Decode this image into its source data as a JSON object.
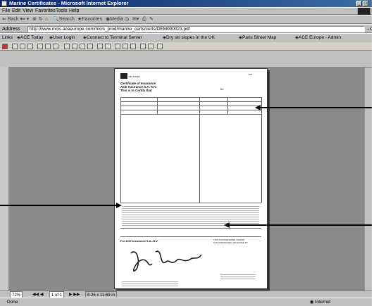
{
  "window": {
    "title": "Marine Certificates - Microsoft Internet Explorer"
  },
  "menu": [
    "File",
    "Edit",
    "View",
    "Favorites",
    "Tools",
    "Help"
  ],
  "nav": {
    "back": "Back",
    "search": "Search",
    "favorites": "Favorites",
    "media": "Media",
    "go": "Go"
  },
  "address": {
    "label": "Address",
    "url": "http://www.mcis.aceeurope.com/mcis_prod/marine_certs/certs/DEM000023.pdf"
  },
  "links": {
    "label": "Links",
    "items": [
      "ACE Today",
      "User Login",
      "Connect to Terminal Server",
      "Dry ski slopes in the UK",
      "Paris Street Map",
      "ACE Europe - Admin"
    ]
  },
  "pdf_nav": {
    "zoom": "72%",
    "page": "1 of 1",
    "size": "8.26 x 11.69 in"
  },
  "status": {
    "left": "Done",
    "right": "Internet"
  },
  "document": {
    "company_small": "ace europe",
    "heading": "Certificate of Insurance",
    "company": "ACE Insurance S.A.-N.V.",
    "certify": "This is to Certify that",
    "cert_no_label": "No.",
    "signed_for": "For ACE Insurance S.A.-N.V.",
    "not_transferable": "THIS TRANSFERABLE UNLESS COUNTERSIGNED AND DATED BY"
  },
  "colors": {
    "titlebar_start": "#0a246a",
    "titlebar_end": "#3a6ea5",
    "chrome": "#c0c0c0",
    "doc_background": "#8a8a8a"
  }
}
